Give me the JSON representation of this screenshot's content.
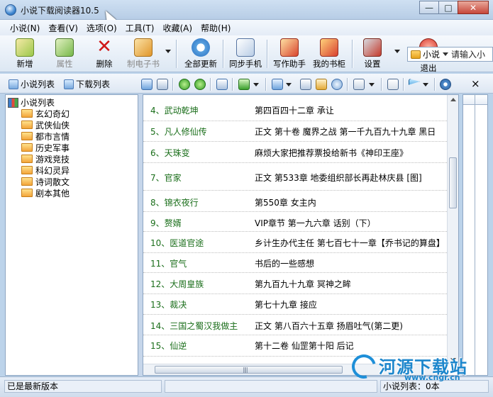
{
  "window": {
    "title": "小说下载阅读器10.5",
    "buttons": {
      "minimize": "—",
      "maximize": "□",
      "close": "✕"
    }
  },
  "menu": [
    {
      "label": "小说(N)"
    },
    {
      "label": "查看(V)"
    },
    {
      "label": "选项(O)"
    },
    {
      "label": "工具(T)"
    },
    {
      "label": "收藏(A)"
    },
    {
      "label": "帮助(H)"
    }
  ],
  "toolbar": {
    "add": "新增",
    "properties": "属性",
    "delete": "删除",
    "make_ebook": "制电子书",
    "update_all": "全部更新",
    "sync_phone": "同步手机",
    "writing_helper": "写作助手",
    "my_bookshelf": "我的书柜",
    "settings": "设置",
    "exit": "退出",
    "search_scope": "小说",
    "search_placeholder": "请输入小"
  },
  "secondary": {
    "novel_list_tab": "小说列表",
    "download_list_tab": "下载列表",
    "close": "×"
  },
  "tree": {
    "root": "小说列表",
    "items": [
      "玄幻奇幻",
      "武侠仙侠",
      "都市言情",
      "历史军事",
      "游戏竞技",
      "科幻灵异",
      "诗词散文",
      "剧本其他"
    ]
  },
  "list": {
    "rows": [
      {
        "title": "4、武动乾坤",
        "chapter": "第四百四十二章 承让"
      },
      {
        "title": "5、凡人修仙传",
        "chapter": "正文 第十卷 魔界之战 第一千九百九十九章 黑日"
      },
      {
        "title": "6、天珠变",
        "chapter": "麻烦大家把推荐票投给新书《神印王座》"
      },
      {
        "title": "7、官家",
        "chapter": "正文 第533章 地委组织部长再赴林庆县 [图]"
      },
      {
        "title": "8、锦衣夜行",
        "chapter": "第550章 女主内"
      },
      {
        "title": "9、赘婿",
        "chapter": "VIP章节 第一九六章 话别（下）"
      },
      {
        "title": "10、医道官途",
        "chapter": "乡计生办代主任 第七百七十一章【乔书记的算盘】"
      },
      {
        "title": "11、官气",
        "chapter": "书后的一些感想"
      },
      {
        "title": "12、大周皇族",
        "chapter": "第九百九十九章 冥神之眸"
      },
      {
        "title": "13、裁决",
        "chapter": "第七十九章 接应"
      },
      {
        "title": "14、三国之蜀汉我做主",
        "chapter": "正文 第八百六十五章 扬眉吐气(第二更)"
      },
      {
        "title": "15、仙逆",
        "chapter": "第十二卷 仙罡第十阳 后记"
      }
    ]
  },
  "status": {
    "left": "已是最新版本",
    "right": "小说列表：0本"
  },
  "watermark": {
    "text": "河源下载站",
    "url": "www.cngr.cn"
  }
}
